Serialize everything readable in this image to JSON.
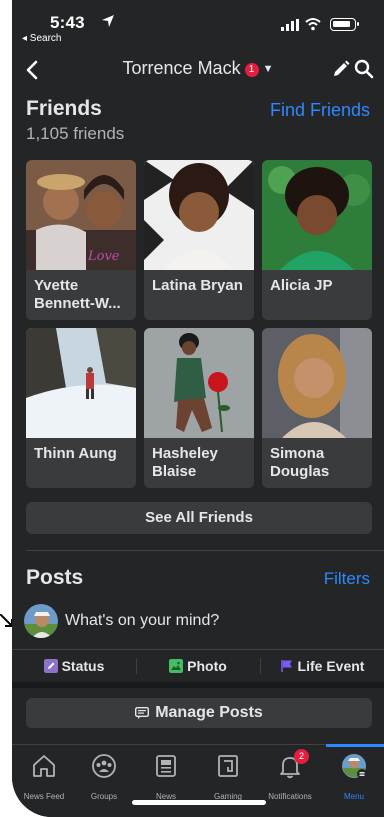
{
  "status_bar": {
    "time": "5:43",
    "back_label": "◂ Search"
  },
  "header": {
    "title": "Torrence Mack",
    "badge": "1"
  },
  "friends": {
    "title": "Friends",
    "find_label": "Find Friends",
    "count": "1,105 friends",
    "items": [
      {
        "name": "Yvette Bennett-W..."
      },
      {
        "name": "Latina Bryan"
      },
      {
        "name": "Alicia JP"
      },
      {
        "name": "Thinn Aung"
      },
      {
        "name": "Hasheley Blaise"
      },
      {
        "name": "Simona Douglas"
      }
    ],
    "see_all_label": "See All Friends"
  },
  "posts": {
    "title": "Posts",
    "filters_label": "Filters",
    "composer_placeholder": "What's on your mind?",
    "actions": [
      {
        "label": "Status",
        "color": "#8c72cb"
      },
      {
        "label": "Photo",
        "color": "#45bd62"
      },
      {
        "label": "Life Event",
        "color": "#7a5af5"
      }
    ],
    "manage_label": "Manage Posts"
  },
  "tabbar": {
    "tabs": [
      {
        "label": "News Feed",
        "icon": "home-icon"
      },
      {
        "label": "Groups",
        "icon": "groups-icon"
      },
      {
        "label": "News",
        "icon": "news-icon"
      },
      {
        "label": "Gaming",
        "icon": "gaming-icon"
      },
      {
        "label": "Notifications",
        "icon": "bell-icon",
        "badge": "2"
      },
      {
        "label": "Menu",
        "icon": "menu-avatar-icon",
        "active": true
      }
    ]
  },
  "colors": {
    "accent": "#2d88ff",
    "badge": "#e41e3f",
    "surface": "#242526",
    "card": "#3a3b3c"
  }
}
